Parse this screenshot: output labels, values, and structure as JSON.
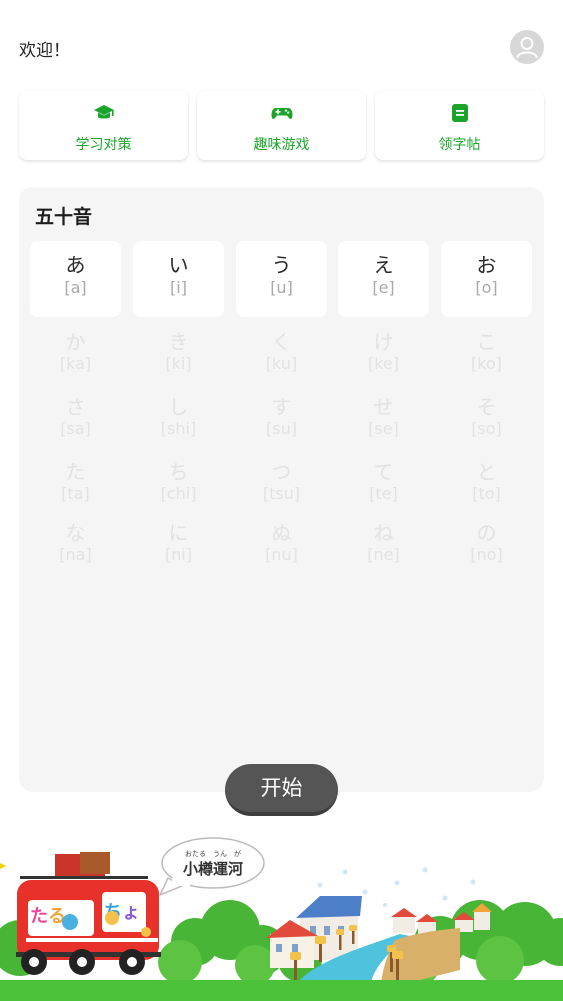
{
  "header": {
    "welcome": "欢迎！",
    "avatar_icon": "user-avatar-icon"
  },
  "cards": [
    {
      "label": "学习对策",
      "icon": "graduation-cap-icon"
    },
    {
      "label": "趣味游戏",
      "icon": "gamepad-icon"
    },
    {
      "label": "领字帖",
      "icon": "copybook-icon"
    }
  ],
  "accent_color": "#1aa52a",
  "gojuon": {
    "title": "五十音",
    "rows": [
      [
        {
          "kana": "あ",
          "romaji": "[a]"
        },
        {
          "kana": "い",
          "romaji": "[i]"
        },
        {
          "kana": "う",
          "romaji": "[u]"
        },
        {
          "kana": "え",
          "romaji": "[e]"
        },
        {
          "kana": "お",
          "romaji": "[o]"
        }
      ],
      [
        {
          "kana": "か",
          "romaji": "[ka]"
        },
        {
          "kana": "き",
          "romaji": "[ki]"
        },
        {
          "kana": "く",
          "romaji": "[ku]"
        },
        {
          "kana": "け",
          "romaji": "[ke]"
        },
        {
          "kana": "こ",
          "romaji": "[ko]"
        }
      ],
      [
        {
          "kana": "さ",
          "romaji": "[sa]"
        },
        {
          "kana": "し",
          "romaji": "[shi]"
        },
        {
          "kana": "す",
          "romaji": "[su]"
        },
        {
          "kana": "せ",
          "romaji": "[se]"
        },
        {
          "kana": "そ",
          "romaji": "[so]"
        }
      ],
      [
        {
          "kana": "た",
          "romaji": "[ta]"
        },
        {
          "kana": "ち",
          "romaji": "[chi]"
        },
        {
          "kana": "つ",
          "romaji": "[tsu]"
        },
        {
          "kana": "て",
          "romaji": "[te]"
        },
        {
          "kana": "と",
          "romaji": "[to]"
        }
      ],
      [
        {
          "kana": "な",
          "romaji": "[na]"
        },
        {
          "kana": "に",
          "romaji": "[ni]"
        },
        {
          "kana": "ぬ",
          "romaji": "[nu]"
        },
        {
          "kana": "ね",
          "romaji": "[ne]"
        },
        {
          "kana": "の",
          "romaji": "[no]"
        }
      ]
    ]
  },
  "start_button": "开始",
  "illustration": {
    "bubble_ruby": "おたる　うん　が",
    "bubble_text": "小樽運河"
  }
}
